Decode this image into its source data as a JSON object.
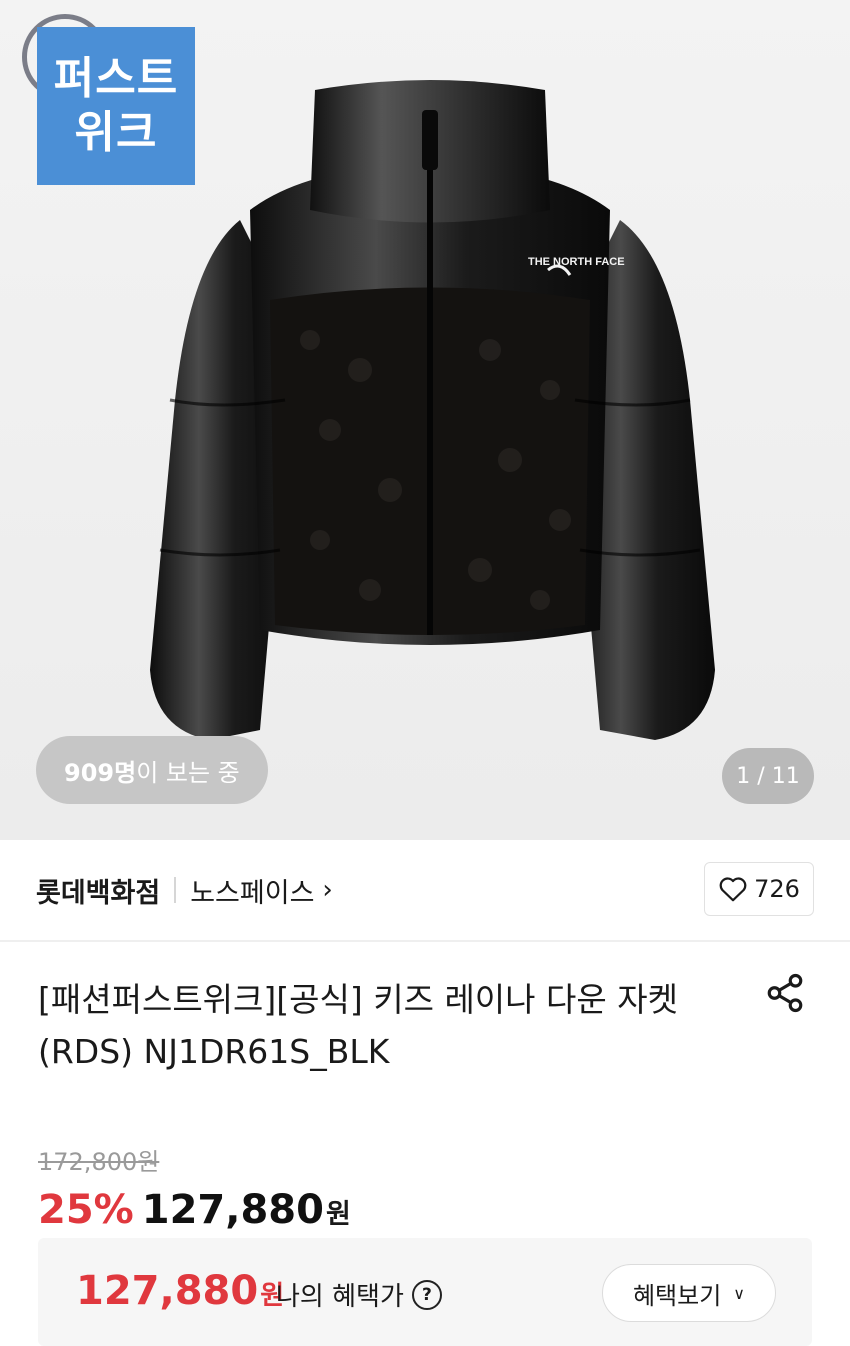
{
  "hero": {
    "badge_line1": "퍼스트",
    "badge_line2": "위크",
    "viewers_count": "909명",
    "viewers_suffix": "이 보는 중",
    "image_counter": "1 / 11",
    "jacket_logo": "THE NORTH FACE"
  },
  "seller": {
    "store": "롯데백화점",
    "brand": "노스페이스",
    "like_count": "726"
  },
  "product": {
    "title_line1": "[패션퍼스트위크][공식] 키즈 레이나 다운 자켓",
    "title_line2": "(RDS) NJ1DR61S_BLK"
  },
  "pricing": {
    "original_price": "172,800원",
    "discount": "25%",
    "sale_price": "127,880",
    "currency": "원"
  },
  "benefit": {
    "price": "127,880",
    "currency": "원",
    "label": "나의 혜택가",
    "button_label": "혜택보기"
  },
  "colors": {
    "accent_red": "#e0383e",
    "badge_blue": "#4b8fd6"
  }
}
